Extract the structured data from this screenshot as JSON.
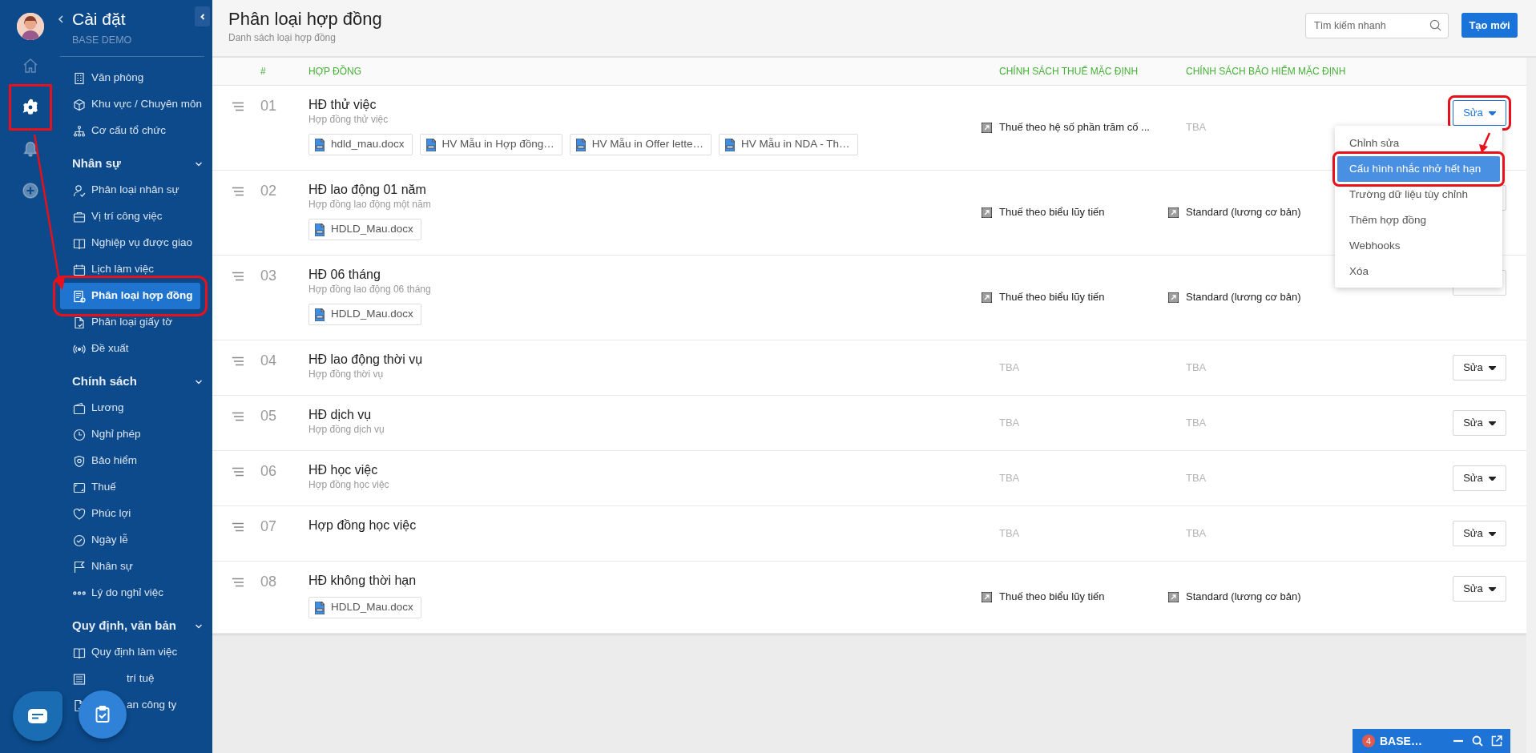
{
  "rail": {
    "items": [
      {
        "selected": false
      },
      {
        "selected": true,
        "highlighted": true
      },
      {
        "selected": false
      },
      {
        "selected": false
      }
    ]
  },
  "sidebar": {
    "title": "Cài đặt",
    "subtitle": "BASE DEMO",
    "sections": [
      {
        "items": [
          {
            "label": "Văn phòng",
            "selected": false
          },
          {
            "label": "Khu vực / Chuyên môn",
            "selected": false
          },
          {
            "label": "Cơ cấu tổ chức",
            "selected": false
          }
        ]
      },
      {
        "heading": "Nhân sự",
        "expanded": true,
        "items": [
          {
            "label": "Phân loại nhân sự",
            "selected": false
          },
          {
            "label": "Vị trí công việc",
            "selected": false
          },
          {
            "label": "Nghiệp vụ được giao",
            "selected": false
          },
          {
            "label": "Lịch làm việc",
            "selected": false
          },
          {
            "label": "Phân loại hợp đồng",
            "selected": true,
            "highlighted": true
          },
          {
            "label": "Phân loại giấy tờ",
            "selected": false
          },
          {
            "label": "Đề xuất",
            "selected": false
          }
        ]
      },
      {
        "heading": "Chính sách",
        "expanded": true,
        "items": [
          {
            "label": "Lương",
            "selected": false
          },
          {
            "label": "Nghỉ phép",
            "selected": false
          },
          {
            "label": "Bảo hiểm",
            "selected": false
          },
          {
            "label": "Thuế",
            "selected": false
          },
          {
            "label": "Phúc lợi",
            "selected": false
          },
          {
            "label": "Ngày lễ",
            "selected": false
          },
          {
            "label": "Nhân sự",
            "selected": false
          },
          {
            "label": "Lý do nghỉ việc",
            "selected": false
          }
        ]
      },
      {
        "heading": "Quy định, văn bản",
        "expanded": true,
        "items": [
          {
            "label": "Quy định làm việc",
            "selected": false
          },
          {
            "kind": "covered",
            "label": "trí tuệ",
            "selected": false
          },
          {
            "kind": "covered",
            "label": "an công ty",
            "selected": false
          }
        ]
      }
    ]
  },
  "header": {
    "title": "Phân loại hợp đồng",
    "subtitle": "Danh sách loại hợp đồng",
    "search": {
      "placeholder": "Tìm kiếm nhanh"
    },
    "create_button": "Tạo mới"
  },
  "table": {
    "columns": [
      "#",
      "HỢP ĐỒNG",
      "CHÍNH SÁCH THUẾ MẶC ĐỊNH",
      "CHÍNH SÁCH BẢO HIỂM MẶC ĐỊNH"
    ],
    "rows": [
      {
        "number": "01",
        "name": "HĐ thử việc",
        "description": "Hợp đồng thử việc",
        "files": [
          "hdld_mau.docx",
          "HV Mẫu in Hợp đồng…",
          "HV Mẫu in Offer lette…",
          "HV Mẫu in NDA - Th…"
        ],
        "tax": {
          "kind": "policy",
          "text": "Thuế theo hệ số phần trăm cố ..."
        },
        "insurance": {
          "kind": "none",
          "text": "TBA"
        },
        "action": {
          "label": "Sửa",
          "active": true,
          "highlighted": true
        }
      },
      {
        "number": "02",
        "name": "HĐ lao động 01 năm",
        "description": "Hợp đồng lao động một năm",
        "files": [
          "HDLD_Mau.docx"
        ],
        "tax": {
          "kind": "policy",
          "text": "Thuế theo biểu lũy tiến"
        },
        "insurance": {
          "kind": "policy",
          "text": "Standard (lương cơ bản)"
        },
        "action": {
          "active": false
        }
      },
      {
        "number": "03",
        "name": "HĐ 06 tháng",
        "description": "Hợp đồng lao động 06 tháng",
        "files": [
          "HDLD_Mau.docx"
        ],
        "tax": {
          "kind": "policy",
          "text": "Thuế theo biểu lũy tiến"
        },
        "insurance": {
          "kind": "policy",
          "text": "Standard (lương cơ bản)"
        },
        "action": {
          "active": false
        }
      },
      {
        "number": "04",
        "name": "HĐ lao động thời vụ",
        "description": "Hợp đồng thời vụ",
        "tax": {
          "kind": "none",
          "text": "TBA"
        },
        "insurance": {
          "kind": "none",
          "text": "TBA"
        },
        "action": {
          "label": "Sửa",
          "active": false
        }
      },
      {
        "number": "05",
        "name": "HĐ dịch vụ",
        "description": "Hợp đồng dịch vụ",
        "tax": {
          "kind": "none",
          "text": "TBA"
        },
        "insurance": {
          "kind": "none",
          "text": "TBA"
        },
        "action": {
          "label": "Sửa",
          "active": false
        }
      },
      {
        "number": "06",
        "name": "HĐ học việc",
        "description": "Hợp đồng học việc",
        "tax": {
          "kind": "none",
          "text": "TBA"
        },
        "insurance": {
          "kind": "none",
          "text": "TBA"
        },
        "action": {
          "label": "Sửa",
          "active": false
        }
      },
      {
        "number": "07",
        "name": "Hợp đồng học việc",
        "tax": {
          "kind": "none",
          "text": "TBA"
        },
        "insurance": {
          "kind": "none",
          "text": "TBA"
        },
        "action": {
          "label": "Sửa",
          "active": false
        }
      },
      {
        "number": "08",
        "name": "HĐ không thời hạn",
        "files": [
          "HDLD_Mau.docx"
        ],
        "tax": {
          "kind": "policy",
          "text": "Thuế theo biểu lũy tiến"
        },
        "insurance": {
          "kind": "policy",
          "text": "Standard (lương cơ bản)"
        },
        "action": {
          "label": "Sửa",
          "active": false
        }
      }
    ],
    "row_menu": {
      "items": [
        {
          "label": "Chỉnh sửa",
          "selected": false
        },
        {
          "label": "Cấu hình nhắc nhở hết hạn",
          "selected": true,
          "highlighted": true
        },
        {
          "label": "Trường dữ liệu tùy chỉnh",
          "selected": false
        },
        {
          "label": "Thêm hợp đồng",
          "selected": false
        },
        {
          "label": "Webhooks",
          "selected": false
        },
        {
          "label": "Xóa",
          "selected": false
        }
      ]
    }
  },
  "chat_widget": {
    "badge": "4",
    "title": "BASE…"
  }
}
